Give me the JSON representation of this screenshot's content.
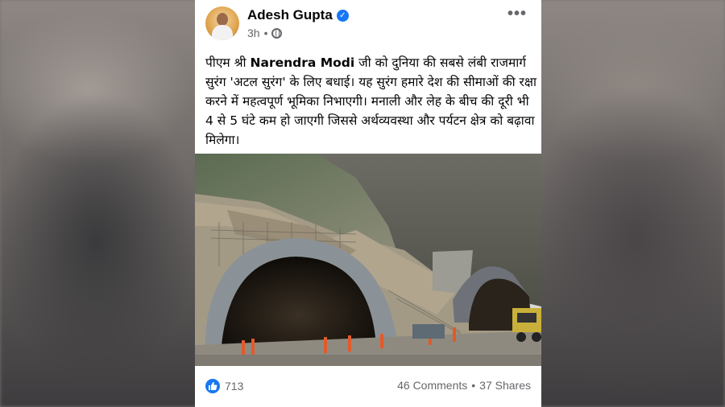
{
  "post": {
    "author": "Adesh Gupta",
    "time": "3h",
    "text_before": "पीएम श्री ",
    "text_bold": "Narendra Modi",
    "text_after": " जी को दुनिया की सबसे लंबी राजमार्ग सुरंग 'अटल सुरंग' के लिए बधाई। यह सुरंग हमारे देश की सीमाओं की रक्षा करने में महत्वपूर्ण भूमिका निभाएगी। मनाली और लेह के बीच की दूरी भी 4 से 5 घंटे कम हो जाएगी जिससे अर्थव्यवस्था और पर्यटन क्षेत्र को बढ़ावा मिलेगा।",
    "more_label": "•••"
  },
  "reactions": {
    "like_count": "713",
    "comments": "46 Comments",
    "separator": "•",
    "shares": "37 Shares"
  },
  "icons": {
    "verified": "verified-badge-icon",
    "privacy": "globe-icon",
    "reaction": "like-icon"
  },
  "colors": {
    "facebook_blue": "#1877f2",
    "meta_gray": "#65676b"
  }
}
